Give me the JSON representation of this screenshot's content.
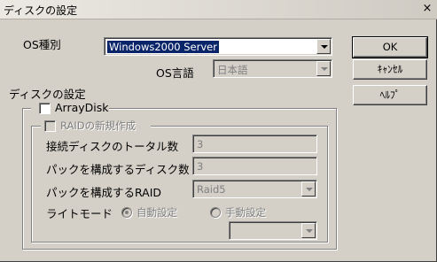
{
  "window": {
    "title": "ディスクの設定",
    "close_glyph": "×"
  },
  "os_type": {
    "label": "OS種別",
    "value": "Windows2000 Server"
  },
  "os_language": {
    "label": "OS言語",
    "value": "日本語"
  },
  "disk_settings": {
    "section_label": "ディスクの設定"
  },
  "array_disk": {
    "label": "ArrayDisk",
    "checked": false,
    "raid_new": {
      "label": "RAIDの新規作成",
      "checked": false,
      "total_disks": {
        "label": "接続ディスクのトータル数",
        "value": "3"
      },
      "pack_disks": {
        "label": "パックを構成するディスク数",
        "value": "3"
      },
      "pack_raid": {
        "label": "パックを構成するRAID",
        "value": "Raid5"
      },
      "write_mode": {
        "label": "ライトモード",
        "options": [
          "自動設定",
          "手動設定"
        ],
        "selected": "自動設定",
        "manual_value": ""
      }
    }
  },
  "buttons": {
    "ok": "OK",
    "cancel": "ｷｬﾝｾﾙ",
    "help": "ﾍﾙﾌﾟ"
  }
}
